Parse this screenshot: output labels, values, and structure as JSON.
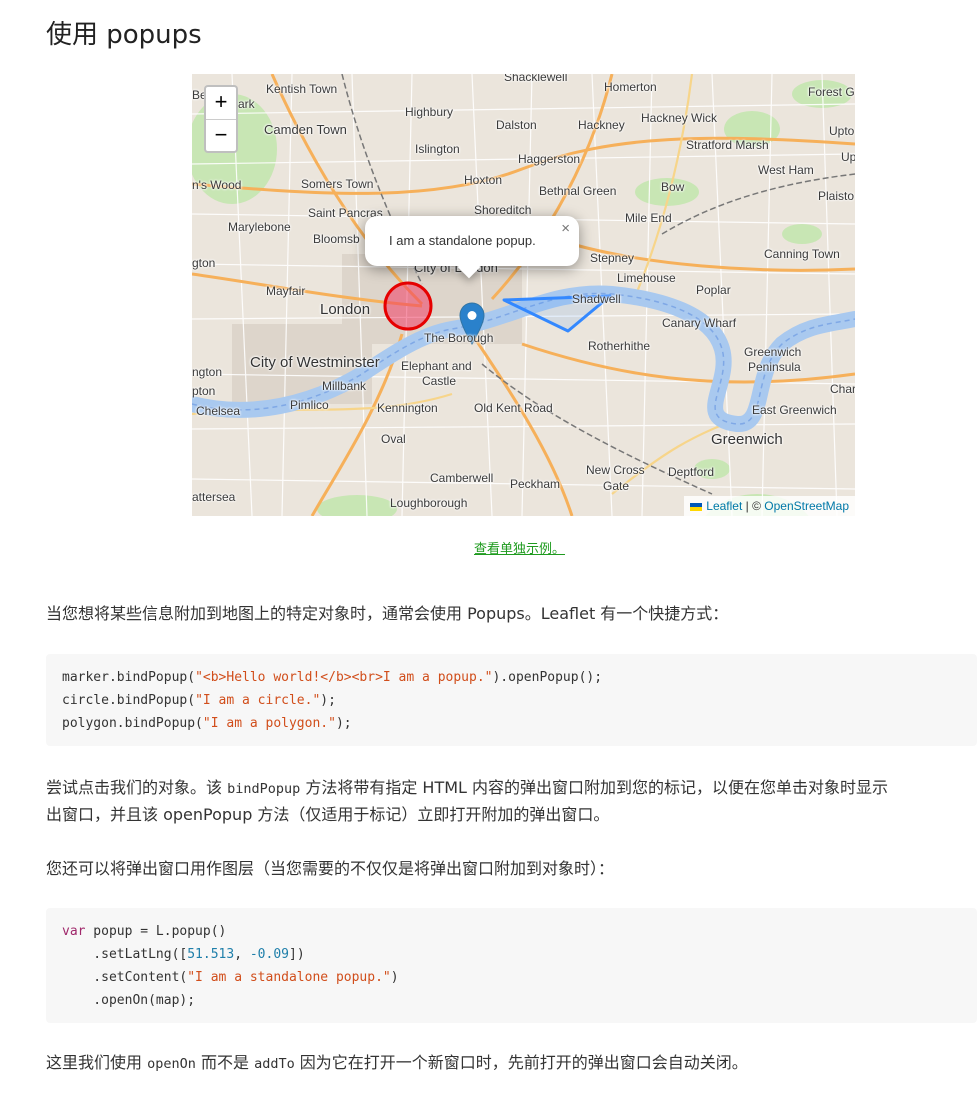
{
  "page": {
    "title": "使用 popups",
    "example_link": "查看单独示例。",
    "intro": "当您想将某些信息附加到地图上的特定对象时，通常会使用 Popups。Leaflet 有一个快捷方式：",
    "explain_line1": {
      "a": "尝试点击我们的对象。该 ",
      "code1": "bindPopup",
      "b": " 方法将带有指定 HTML 内容的弹出窗口附加到您的标记，以便在您单击对象时显示"
    },
    "explain_line2": {
      "a": "出窗口，并且该 ",
      "code1": "openPopup",
      "b": " 方法（仅适用于标记）立即打开附加的弹出窗口。"
    },
    "layer_intro": "您还可以将弹出窗口用作图层（当您需要的不仅仅是将弹出窗口附加到对象时）：",
    "outro": {
      "a": "这里我们使用 ",
      "code1": "openOn",
      "b": " 而不是 ",
      "code2": "addTo",
      "c": " 因为它在打开一个新窗口时，先前打开的弹出窗口会自动关闭。"
    }
  },
  "code1": {
    "l1a": "marker.bindPopup(",
    "l1s": "\"<b>Hello world!</b><br>I am a popup.\"",
    "l1b": ").openPopup();",
    "l2a": "circle.bindPopup(",
    "l2s": "\"I am a circle.\"",
    "l2b": ");",
    "l3a": "polygon.bindPopup(",
    "l3s": "\"I am a polygon.\"",
    "l3b": ");"
  },
  "code2": {
    "l1k": "var",
    "l1a": " popup = L.popup()",
    "l2a": "    .setLatLng([",
    "l2n1": "51.513",
    "l2c": ", ",
    "l2n2": "-0.09",
    "l2b": "])",
    "l3a": "    .setContent(",
    "l3s": "\"I am a standalone popup.\"",
    "l3b": ")",
    "l4a": "    .openOn(map);"
  },
  "map": {
    "zoom_in": "+",
    "zoom_out": "−",
    "popup_text": "I am a standalone popup.",
    "popup_close": "×",
    "attribution": {
      "leaflet": "Leaflet",
      "sep": " | © ",
      "osm": "OpenStreetMap"
    },
    "labels": {
      "shacklewell": "Shacklewell",
      "homerton": "Homerton",
      "forest_gate": "Forest G",
      "kentish_town": "Kentish Town",
      "highbury": "Highbury",
      "dalston": "Dalston",
      "hackney": "Hackney",
      "hackney_wick": "Hackney Wick",
      "upton": "Upto",
      "belsize": "Bel",
      "park": "ark",
      "camden_town": "Camden Town",
      "islington": "Islington",
      "haggerston": "Haggerston",
      "stratford_marsh": "Stratford Marsh",
      "up": "Up",
      "johns_wood": "n's Wood",
      "somers_town": "Somers Town",
      "hoxton": "Hoxton",
      "bethnal_green": "Bethnal Green",
      "bow": "Bow",
      "west_ham": "West Ham",
      "plaistow": "Plaisto",
      "saint_pancras": "Saint Pancras",
      "shoreditch": "Shoreditch",
      "mile_end": "Mile End",
      "marylebone": "Marylebone",
      "bloomsbury": "Bloomsb",
      "stepney": "Stepney",
      "canning_town": "Canning Town",
      "gton": "gton",
      "city_of_london": "City of London",
      "limehouse": "Limehouse",
      "mayfair": "Mayfair",
      "poplar": "Poplar",
      "london": "London",
      "shadwell": "Shadwell",
      "canary_wharf": "Canary Wharf",
      "the_borough": "The Borough",
      "rotherhithe": "Rotherhithe",
      "greenwich_peninsula1": "Greenwich",
      "greenwich_peninsula2": "Peninsula",
      "city_of_westminster": "City of Westminster",
      "elephant1": "Elephant and",
      "elephant2": "Castle",
      "ngton": "ngton",
      "millbank": "Millbank",
      "pton": "pton",
      "char": "Char",
      "chelsea": "Chelsea",
      "pimlico": "Pimlico",
      "kennington": "Kennington",
      "old_kent_road": "Old Kent Road",
      "east_greenwich": "East Greenwich",
      "oval": "Oval",
      "greenwich": "Greenwich",
      "new_cross": "New Cross",
      "gate": "Gate",
      "deptford": "Deptford",
      "camberwell": "Camberwell",
      "peckham": "Peckham",
      "battersea": "attersea",
      "loughborough": "Loughborough"
    }
  },
  "colors": {
    "circle_stroke": "#e60000",
    "circle_fill": "#f03c64",
    "polygon": "#3388ff",
    "marker": "#2a81cb",
    "link": "#1f9b1f",
    "string": "#d14e1b",
    "number": "#1f7faa",
    "keyword": "#a0286b"
  }
}
